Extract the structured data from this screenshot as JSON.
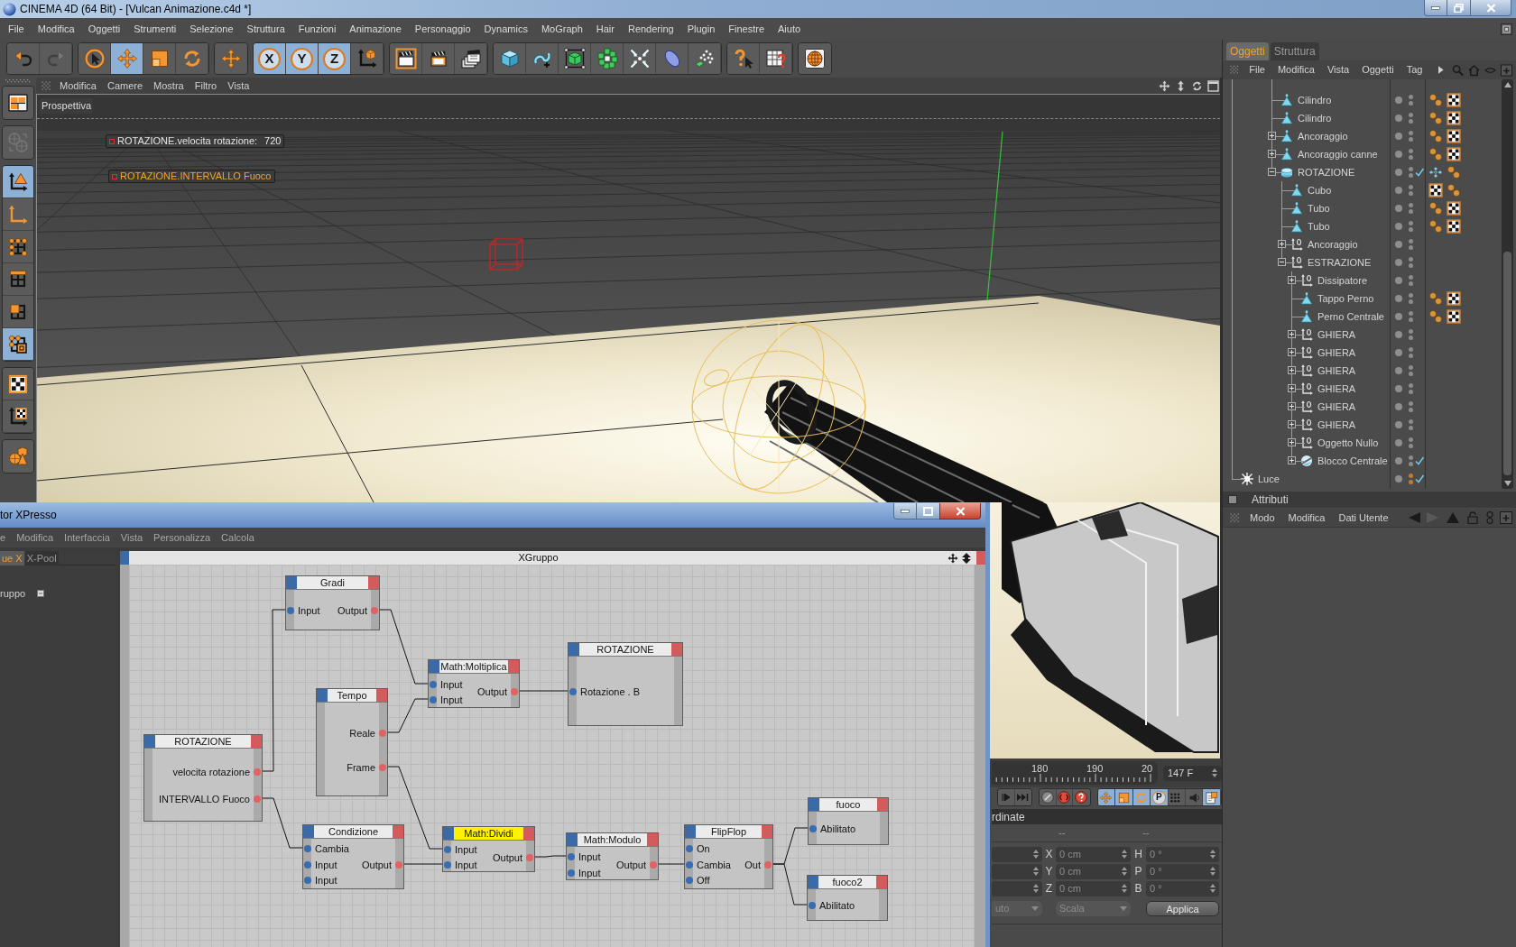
{
  "window": {
    "title": "CINEMA 4D (64 Bit) - [Vulcan Animazione.c4d *]"
  },
  "menu": [
    "File",
    "Modifica",
    "Oggetti",
    "Strumenti",
    "Selezione",
    "Struttura",
    "Funzioni",
    "Animazione",
    "Personaggio",
    "Dynamics",
    "MoGraph",
    "Hair",
    "Rendering",
    "Plugin",
    "Finestre",
    "Aiuto"
  ],
  "toolbar": [
    [
      {
        "kind": "undo",
        "disabled": false
      },
      {
        "kind": "redo",
        "disabled": true
      }
    ],
    [
      {
        "kind": "select",
        "selected": false
      },
      {
        "kind": "move",
        "selected": true
      },
      {
        "kind": "scale",
        "selected": false
      },
      {
        "kind": "rotate",
        "selected": false
      }
    ],
    [
      {
        "kind": "tool"
      }
    ],
    [
      {
        "kind": "axis",
        "label": "X",
        "selected": true
      },
      {
        "kind": "axis",
        "label": "Y",
        "selected": true
      },
      {
        "kind": "axis",
        "label": "Z",
        "selected": true
      },
      {
        "kind": "coordinates"
      }
    ],
    [
      {
        "kind": "render-view"
      },
      {
        "kind": "render"
      },
      {
        "kind": "render-settings"
      }
    ],
    [
      {
        "kind": "cube"
      },
      {
        "kind": "spline"
      },
      {
        "kind": "subdivision"
      },
      {
        "kind": "cloner"
      },
      {
        "kind": "deformer"
      },
      {
        "kind": "environment"
      },
      {
        "kind": "emitter"
      }
    ],
    [
      {
        "kind": "help"
      },
      {
        "kind": "table"
      }
    ],
    [
      {
        "kind": "globe"
      }
    ]
  ],
  "mode_toolbar": [
    [
      {
        "kind": "layout"
      }
    ],
    [
      {
        "kind": "convert",
        "disabled": true
      }
    ],
    [
      {
        "kind": "model",
        "selected": true
      },
      {
        "kind": "object-axis",
        "selected": false
      },
      {
        "kind": "points",
        "selected": false
      },
      {
        "kind": "edges",
        "selected": false
      },
      {
        "kind": "polygons",
        "selected": false
      },
      {
        "kind": "tweak",
        "selected": true
      }
    ],
    [
      {
        "kind": "texture",
        "selected": false
      },
      {
        "kind": "texture-axis",
        "selected": false
      }
    ],
    [
      {
        "kind": "primitives"
      }
    ]
  ],
  "viewport": {
    "menu": [
      "Modifica",
      "Camere",
      "Mostra",
      "Filtro",
      "Vista"
    ],
    "camera": "Prospettiva",
    "hud": [
      {
        "label": "ROTAZIONE.velocita rotazione:",
        "value": "720",
        "selected": false
      },
      {
        "label": "ROTAZIONE.INTERVALLO Fuoco",
        "selected": true
      }
    ]
  },
  "timeline": {
    "ticks": [
      "180",
      "190",
      "20"
    ],
    "frame": "147 F",
    "key_filters": [
      {
        "kind": "position",
        "selected": true
      },
      {
        "kind": "scale",
        "selected": true
      },
      {
        "kind": "rotation",
        "selected": true
      },
      {
        "kind": "parameter",
        "label": "P",
        "selected": true
      },
      {
        "kind": "points",
        "selected": false
      },
      {
        "kind": "pla",
        "selected": false
      },
      {
        "kind": "document",
        "selected": true
      }
    ]
  },
  "coordinates": {
    "title": "rdinate",
    "disabled": true,
    "headers": [
      "--",
      "--"
    ],
    "rows": [
      {
        "axis": "X",
        "value": "0 cm",
        "angle_axis": "H",
        "angle": "0 °"
      },
      {
        "axis": "Y",
        "value": "0 cm",
        "angle_axis": "P",
        "angle": "0 °"
      },
      {
        "axis": "Z",
        "value": "0 cm",
        "angle_axis": "B",
        "angle": "0 °"
      }
    ],
    "mode": "uto",
    "space": "Scala",
    "apply": "Applica"
  },
  "object_manager": {
    "tabs": [
      {
        "label": "Oggetti",
        "selected": true
      },
      {
        "label": "Struttura",
        "selected": false
      }
    ],
    "menu": [
      "File",
      "Modifica",
      "Vista",
      "Oggetti",
      "Tag"
    ],
    "tree": [
      {
        "name": "Cilindro",
        "kind": "polygon",
        "color": "#8c8c8c",
        "tags": [
          {
            "kind": "phong"
          },
          {
            "kind": "texture"
          }
        ]
      },
      {
        "name": "Cilindro",
        "kind": "polygon",
        "color": "#8c8c8c",
        "tags": [
          {
            "kind": "phong"
          },
          {
            "kind": "texture"
          }
        ]
      },
      {
        "name": "Ancoraggio",
        "kind": "polygon",
        "expanded": false,
        "color": "#8c8c8c",
        "tags": [
          {
            "kind": "phong"
          },
          {
            "kind": "texture"
          }
        ]
      },
      {
        "name": "Ancoraggio canne",
        "kind": "polygon",
        "expanded": false,
        "color": "#8c8c8c",
        "tags": [
          {
            "kind": "phong"
          },
          {
            "kind": "texture"
          }
        ]
      },
      {
        "name": "ROTAZIONE",
        "kind": "disc",
        "expanded": true,
        "enabled": true,
        "color": "#8c8c8c",
        "tags": [
          {
            "kind": "xpresso"
          },
          {
            "kind": "phong"
          }
        ],
        "children": [
          {
            "name": "Cubo",
            "kind": "polygon",
            "color": "#8c8c8c",
            "tags": [
              {
                "kind": "texture"
              },
              {
                "kind": "phong"
              }
            ]
          },
          {
            "name": "Tubo",
            "kind": "polygon",
            "color": "#8c8c8c",
            "tags": [
              {
                "kind": "phong"
              },
              {
                "kind": "texture"
              }
            ]
          },
          {
            "name": "Tubo",
            "kind": "polygon",
            "color": "#8c8c8c",
            "tags": [
              {
                "kind": "phong"
              },
              {
                "kind": "texture"
              }
            ]
          },
          {
            "name": "Ancoraggio",
            "kind": "null",
            "expanded": false,
            "color": "#8c8c8c"
          },
          {
            "name": "ESTRAZIONE",
            "kind": "null",
            "expanded": true,
            "color": "#8c8c8c",
            "children": [
              {
                "name": "Dissipatore",
                "kind": "null",
                "expanded": false,
                "color": "#8c8c8c"
              },
              {
                "name": "Tappo Perno",
                "kind": "polygon",
                "color": "#8c8c8c",
                "tags": [
                  {
                    "kind": "phong"
                  },
                  {
                    "kind": "texture"
                  }
                ]
              },
              {
                "name": "Perno Centrale",
                "kind": "polygon",
                "color": "#8c8c8c",
                "tags": [
                  {
                    "kind": "phong"
                  },
                  {
                    "kind": "texture"
                  }
                ]
              },
              {
                "name": "GHIERA",
                "kind": "null",
                "expanded": false,
                "color": "#8c8c8c"
              },
              {
                "name": "GHIERA",
                "kind": "null",
                "expanded": false,
                "color": "#8c8c8c"
              },
              {
                "name": "GHIERA",
                "kind": "null",
                "expanded": false,
                "color": "#8c8c8c"
              },
              {
                "name": "GHIERA",
                "kind": "null",
                "expanded": false,
                "color": "#8c8c8c"
              },
              {
                "name": "GHIERA",
                "kind": "null",
                "expanded": false,
                "color": "#8c8c8c"
              },
              {
                "name": "GHIERA",
                "kind": "null",
                "expanded": false,
                "color": "#8c8c8c"
              },
              {
                "name": "Oggetto Nullo",
                "kind": "null",
                "expanded": false,
                "color": "#8c8c8c"
              },
              {
                "name": "Blocco Centrale",
                "kind": "sphere",
                "expanded": false,
                "enabled": true,
                "color": "#8c8c8c"
              }
            ]
          }
        ]
      }
    ],
    "root_items": [
      {
        "name": "Luce",
        "kind": "light",
        "enabled": true,
        "color": "#c8782e"
      }
    ]
  },
  "attributes": {
    "title": "Attributi",
    "menu": [
      "Modo",
      "Modifica",
      "Dati Utente"
    ]
  },
  "xpresso": {
    "title": "tor XPresso",
    "menu": [
      "e",
      "Modifica",
      "Interfaccia",
      "Vista",
      "Personalizza",
      "Calcola"
    ],
    "tabs": [
      {
        "label": "ue X",
        "selected": true
      },
      {
        "label": "X-Pool",
        "selected": false
      }
    ],
    "pool_items": [
      "ruppo"
    ],
    "editor_title": "XGruppo",
    "nodes": [
      {
        "title": "Gradi",
        "selected": false,
        "inputs": [
          "Input"
        ],
        "outputs": [
          "Output"
        ]
      },
      {
        "title": "Math:Moltiplica",
        "selected": false,
        "inputs": [
          "Input",
          "Input"
        ],
        "outputs": [
          "Output"
        ]
      },
      {
        "title": "ROTAZIONE",
        "selected": false,
        "inputs": [
          "Rotazione . B"
        ]
      },
      {
        "title": "Tempo",
        "selected": false,
        "outputs": [
          "Reale",
          "Frame"
        ]
      },
      {
        "title": "ROTAZIONE",
        "selected": false,
        "outputs": [
          "velocita rotazione",
          "INTERVALLO Fuoco"
        ]
      },
      {
        "title": "Condizione",
        "selected": false,
        "inputs": [
          "Cambia",
          "Input",
          "Input"
        ],
        "outputs": [
          "Output"
        ]
      },
      {
        "title": "Math:Dividi",
        "selected": true,
        "inputs": [
          "Input",
          "Input"
        ],
        "outputs": [
          "Output"
        ]
      },
      {
        "title": "Math:Modulo",
        "selected": false,
        "inputs": [
          "Input",
          "Input"
        ],
        "outputs": [
          "Output"
        ]
      },
      {
        "title": "FlipFlop",
        "selected": false,
        "inputs": [
          "On",
          "Cambia",
          "Off"
        ],
        "outputs": [
          "Out"
        ]
      },
      {
        "title": "fuoco",
        "selected": false,
        "inputs": [
          "Abilitato"
        ]
      },
      {
        "title": "fuoco2",
        "selected": false,
        "inputs": [
          "Abilitato"
        ]
      }
    ]
  }
}
